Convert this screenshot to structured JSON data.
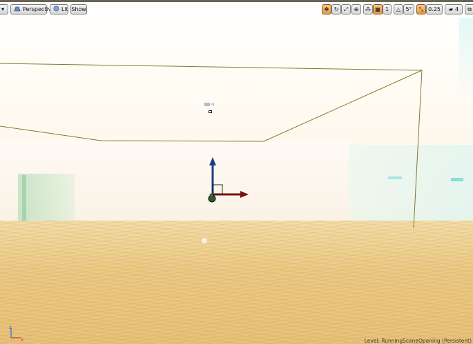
{
  "toolbar": {
    "menu_glyph": "▾",
    "perspective_label": "Perspective",
    "perspective_icon": "viewport-perspective-icon",
    "lit_label": "Lit",
    "lit_icon": "lit-sphere-icon",
    "show_label": "Show",
    "snap_grid_value": "1",
    "snap_rotate_value": "5°",
    "snap_scale_value": "0.25",
    "camera_speed_value": "4",
    "accent_color": "#e09a45"
  },
  "status": {
    "level_text": "Level:  RunningSceneOpening (Persistent)"
  },
  "axis_indicator": {
    "z_label": "z",
    "x_label": "x"
  }
}
